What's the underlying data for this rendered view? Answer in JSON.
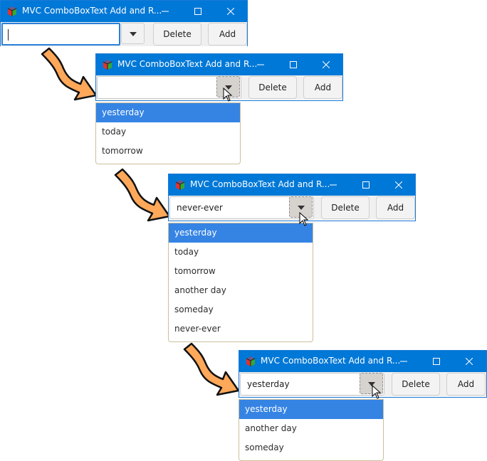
{
  "windows": [
    {
      "title": "MVC ComboBoxText Add and R...",
      "combo_value": "",
      "delete_label": "Delete",
      "add_label": "Add"
    },
    {
      "title": "MVC ComboBoxText Add and R...",
      "combo_value": "",
      "delete_label": "Delete",
      "add_label": "Add",
      "popup_items": [
        "yesterday",
        "today",
        "tomorrow"
      ]
    },
    {
      "title": "MVC ComboBoxText Add and R...",
      "combo_value": "never-ever",
      "delete_label": "Delete",
      "add_label": "Add",
      "popup_items": [
        "yesterday",
        "today",
        "tomorrow",
        "another day",
        "someday",
        "never-ever"
      ]
    },
    {
      "title": "MVC ComboBoxText Add and R...",
      "combo_value": "yesterday",
      "delete_label": "Delete",
      "add_label": "Add",
      "popup_items": [
        "yesterday",
        "another day",
        "someday"
      ]
    }
  ],
  "icons": {
    "app": "gtk-cube-icon",
    "minimize": "minimize-icon",
    "maximize": "maximize-icon",
    "close": "close-icon",
    "dropdown": "triangle-down-icon",
    "pointer": "mouse-pointer-icon",
    "step_arrow": "curved-arrow-icon"
  },
  "colors": {
    "titlebar": "#0078d7",
    "selection": "#3584e4",
    "arrow_fill": "#ffa85a"
  }
}
